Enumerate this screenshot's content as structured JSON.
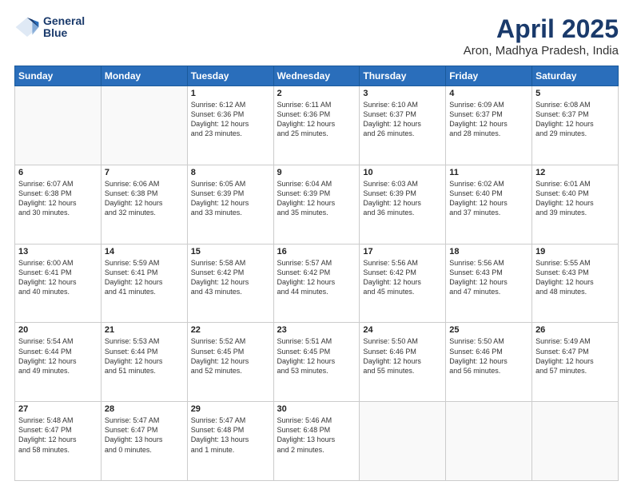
{
  "header": {
    "logo_line1": "General",
    "logo_line2": "Blue",
    "month": "April 2025",
    "location": "Aron, Madhya Pradesh, India"
  },
  "days_of_week": [
    "Sunday",
    "Monday",
    "Tuesday",
    "Wednesday",
    "Thursday",
    "Friday",
    "Saturday"
  ],
  "weeks": [
    [
      {
        "day": "",
        "info": ""
      },
      {
        "day": "",
        "info": ""
      },
      {
        "day": "1",
        "info": "Sunrise: 6:12 AM\nSunset: 6:36 PM\nDaylight: 12 hours\nand 23 minutes."
      },
      {
        "day": "2",
        "info": "Sunrise: 6:11 AM\nSunset: 6:36 PM\nDaylight: 12 hours\nand 25 minutes."
      },
      {
        "day": "3",
        "info": "Sunrise: 6:10 AM\nSunset: 6:37 PM\nDaylight: 12 hours\nand 26 minutes."
      },
      {
        "day": "4",
        "info": "Sunrise: 6:09 AM\nSunset: 6:37 PM\nDaylight: 12 hours\nand 28 minutes."
      },
      {
        "day": "5",
        "info": "Sunrise: 6:08 AM\nSunset: 6:37 PM\nDaylight: 12 hours\nand 29 minutes."
      }
    ],
    [
      {
        "day": "6",
        "info": "Sunrise: 6:07 AM\nSunset: 6:38 PM\nDaylight: 12 hours\nand 30 minutes."
      },
      {
        "day": "7",
        "info": "Sunrise: 6:06 AM\nSunset: 6:38 PM\nDaylight: 12 hours\nand 32 minutes."
      },
      {
        "day": "8",
        "info": "Sunrise: 6:05 AM\nSunset: 6:39 PM\nDaylight: 12 hours\nand 33 minutes."
      },
      {
        "day": "9",
        "info": "Sunrise: 6:04 AM\nSunset: 6:39 PM\nDaylight: 12 hours\nand 35 minutes."
      },
      {
        "day": "10",
        "info": "Sunrise: 6:03 AM\nSunset: 6:39 PM\nDaylight: 12 hours\nand 36 minutes."
      },
      {
        "day": "11",
        "info": "Sunrise: 6:02 AM\nSunset: 6:40 PM\nDaylight: 12 hours\nand 37 minutes."
      },
      {
        "day": "12",
        "info": "Sunrise: 6:01 AM\nSunset: 6:40 PM\nDaylight: 12 hours\nand 39 minutes."
      }
    ],
    [
      {
        "day": "13",
        "info": "Sunrise: 6:00 AM\nSunset: 6:41 PM\nDaylight: 12 hours\nand 40 minutes."
      },
      {
        "day": "14",
        "info": "Sunrise: 5:59 AM\nSunset: 6:41 PM\nDaylight: 12 hours\nand 41 minutes."
      },
      {
        "day": "15",
        "info": "Sunrise: 5:58 AM\nSunset: 6:42 PM\nDaylight: 12 hours\nand 43 minutes."
      },
      {
        "day": "16",
        "info": "Sunrise: 5:57 AM\nSunset: 6:42 PM\nDaylight: 12 hours\nand 44 minutes."
      },
      {
        "day": "17",
        "info": "Sunrise: 5:56 AM\nSunset: 6:42 PM\nDaylight: 12 hours\nand 45 minutes."
      },
      {
        "day": "18",
        "info": "Sunrise: 5:56 AM\nSunset: 6:43 PM\nDaylight: 12 hours\nand 47 minutes."
      },
      {
        "day": "19",
        "info": "Sunrise: 5:55 AM\nSunset: 6:43 PM\nDaylight: 12 hours\nand 48 minutes."
      }
    ],
    [
      {
        "day": "20",
        "info": "Sunrise: 5:54 AM\nSunset: 6:44 PM\nDaylight: 12 hours\nand 49 minutes."
      },
      {
        "day": "21",
        "info": "Sunrise: 5:53 AM\nSunset: 6:44 PM\nDaylight: 12 hours\nand 51 minutes."
      },
      {
        "day": "22",
        "info": "Sunrise: 5:52 AM\nSunset: 6:45 PM\nDaylight: 12 hours\nand 52 minutes."
      },
      {
        "day": "23",
        "info": "Sunrise: 5:51 AM\nSunset: 6:45 PM\nDaylight: 12 hours\nand 53 minutes."
      },
      {
        "day": "24",
        "info": "Sunrise: 5:50 AM\nSunset: 6:46 PM\nDaylight: 12 hours\nand 55 minutes."
      },
      {
        "day": "25",
        "info": "Sunrise: 5:50 AM\nSunset: 6:46 PM\nDaylight: 12 hours\nand 56 minutes."
      },
      {
        "day": "26",
        "info": "Sunrise: 5:49 AM\nSunset: 6:47 PM\nDaylight: 12 hours\nand 57 minutes."
      }
    ],
    [
      {
        "day": "27",
        "info": "Sunrise: 5:48 AM\nSunset: 6:47 PM\nDaylight: 12 hours\nand 58 minutes."
      },
      {
        "day": "28",
        "info": "Sunrise: 5:47 AM\nSunset: 6:47 PM\nDaylight: 13 hours\nand 0 minutes."
      },
      {
        "day": "29",
        "info": "Sunrise: 5:47 AM\nSunset: 6:48 PM\nDaylight: 13 hours\nand 1 minute."
      },
      {
        "day": "30",
        "info": "Sunrise: 5:46 AM\nSunset: 6:48 PM\nDaylight: 13 hours\nand 2 minutes."
      },
      {
        "day": "",
        "info": ""
      },
      {
        "day": "",
        "info": ""
      },
      {
        "day": "",
        "info": ""
      }
    ]
  ]
}
